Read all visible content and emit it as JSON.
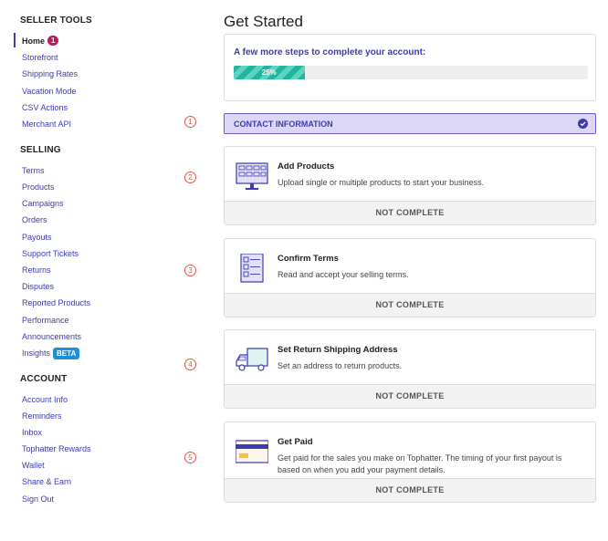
{
  "sidebar": {
    "sections": [
      {
        "title": "SELLER TOOLS"
      },
      {
        "title": "SELLING"
      },
      {
        "title": "ACCOUNT"
      }
    ],
    "seller_tools": [
      "Home",
      "Storefront",
      "Shipping Rates",
      "Vacation Mode",
      "CSV Actions",
      "Merchant API"
    ],
    "home_badge": "1",
    "selling": [
      "Terms",
      "Products",
      "Campaigns",
      "Orders",
      "Payouts",
      "Support Tickets",
      "Returns",
      "Disputes",
      "Reported Products",
      "Performance",
      "Announcements",
      "Insights"
    ],
    "insights_badge": "BETA",
    "account": [
      "Account Info",
      "Reminders",
      "Inbox",
      "Tophatter Rewards",
      "Wallet",
      "Share & Earn",
      "Sign Out"
    ]
  },
  "step_markers": [
    "1",
    "2",
    "3",
    "4",
    "5"
  ],
  "main": {
    "title": "Get Started",
    "progress": {
      "label": "A few more steps to complete your account:",
      "percent_text": "25%",
      "value": 0.2
    },
    "contact": {
      "label": "CONTACT INFORMATION",
      "icon": "check-circle-icon"
    },
    "steps": [
      {
        "title": "Add Products",
        "desc": "Upload single or multiple products to start your business.",
        "status": "NOT COMPLETE",
        "icon": "monitor-grid-icon"
      },
      {
        "title": "Confirm Terms",
        "desc": "Read and accept your selling terms.",
        "status": "NOT COMPLETE",
        "icon": "checklist-icon"
      },
      {
        "title": "Set Return Shipping Address",
        "desc": "Set an address to return products.",
        "status": "NOT COMPLETE",
        "icon": "truck-icon"
      },
      {
        "title": "Get Paid",
        "desc": "Get paid for the sales you make on Tophatter. The timing of your first payout is based on when you add your payment details.",
        "status": "NOT COMPLETE",
        "icon": "credit-card-icon"
      }
    ]
  },
  "colors": {
    "accent": "#3d3bb0",
    "badge": "#c2185b",
    "beta": "#1f8fd6",
    "progress": "#1fb59f",
    "marker": "#e5533d"
  }
}
